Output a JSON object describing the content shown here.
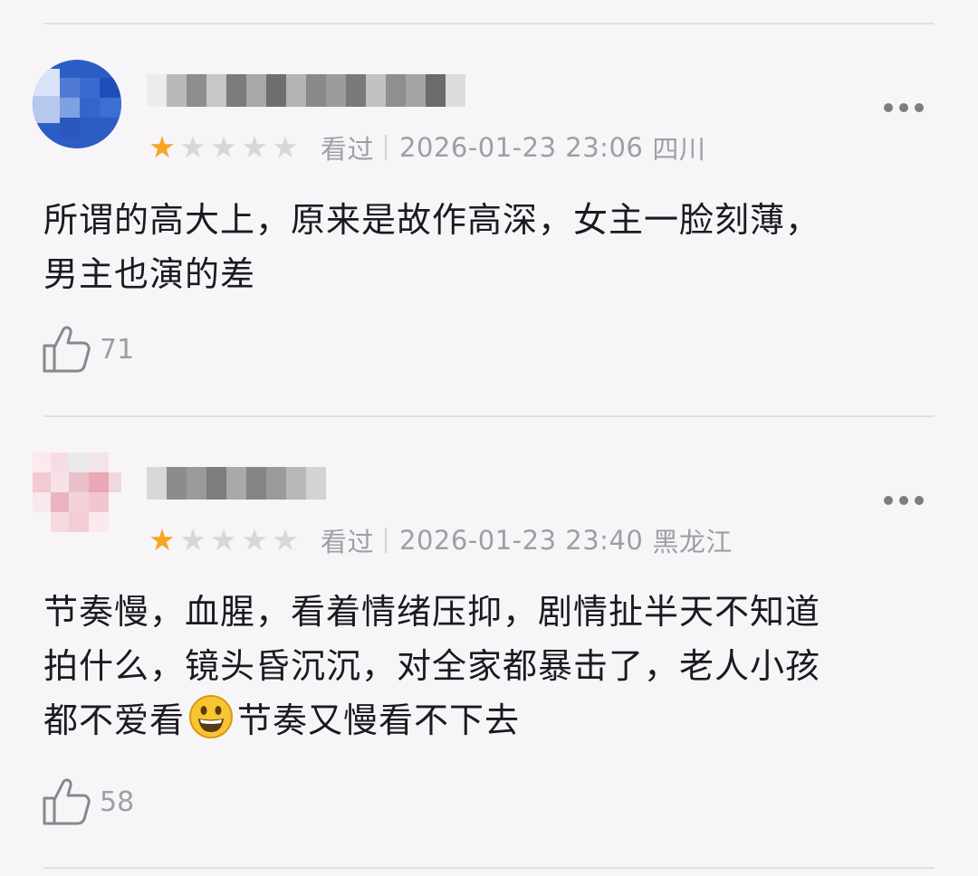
{
  "reviews": [
    {
      "stars_rating": 1,
      "stars_total": 5,
      "status": "看过",
      "datetime": "2026-01-23 23:06",
      "location": "四川",
      "text_lines": [
        "所谓的高大上，原来是故作高深，女主一脸刻薄，",
        "男主也演的差"
      ],
      "likes": "71",
      "avatar_icon": "blurred-avatar",
      "username_icon": "blurred-username"
    },
    {
      "stars_rating": 1,
      "stars_total": 5,
      "status": "看过",
      "datetime": "2026-01-23 23:40",
      "location": "黑龙江",
      "text_lines": [
        "节奏慢，血腥，看着情绪压抑，剧情扯半天不知道",
        "拍什么，镜头昏沉沉，对全家都暴击了，老人小孩"
      ],
      "text_line3_before": "都不爱看",
      "text_line3_after": "节奏又慢看不下去",
      "emoji_icon": "grinning-face-icon",
      "likes": "58",
      "avatar_icon": "blurred-avatar",
      "username_icon": "blurred-username"
    }
  ],
  "colors": {
    "star_on": "#f5a623",
    "star_off": "#d9d6da",
    "muted_text": "#a19ea3",
    "body_text": "#1c1a1e",
    "background": "#f8f5f9"
  },
  "icons": {
    "more": "more-dots-icon",
    "like": "thumbs-up-icon",
    "star": "star-icon"
  }
}
